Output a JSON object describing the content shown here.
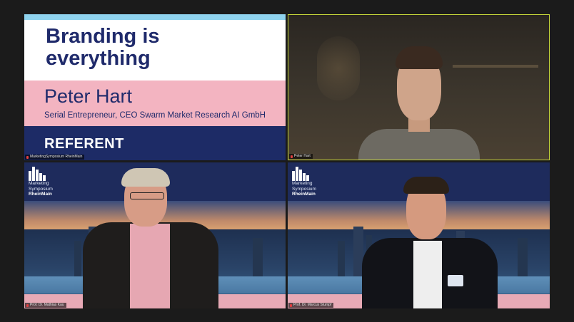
{
  "slide": {
    "title_line1": "Branding is",
    "title_line2": "everything",
    "speaker_name": "Peter Hart",
    "speaker_role": "Serial Entrepreneur, CEO Swarm Market Research AI GmbH",
    "badge": "REFERENT"
  },
  "tiles": {
    "slide_tile": {
      "name_tag": "MarketingSymposium RheinMain"
    },
    "peter": {
      "name_tag": "Peter Hart"
    },
    "mathias": {
      "name_tag": "Prof. Dr. Mathias Kau"
    },
    "marcus": {
      "name_tag": "Prof. Dr. Marcus Stumpf"
    }
  },
  "logo": {
    "line1": "Marketing",
    "line2": "Symposium",
    "line3": "RheinMain"
  },
  "colors": {
    "background": "#1b1b1b",
    "active_speaker_border": "#c8d93a",
    "slide_navy": "#1d2b66",
    "slide_pink": "#f3b4c1",
    "slide_cyan": "#8fd3ee"
  }
}
